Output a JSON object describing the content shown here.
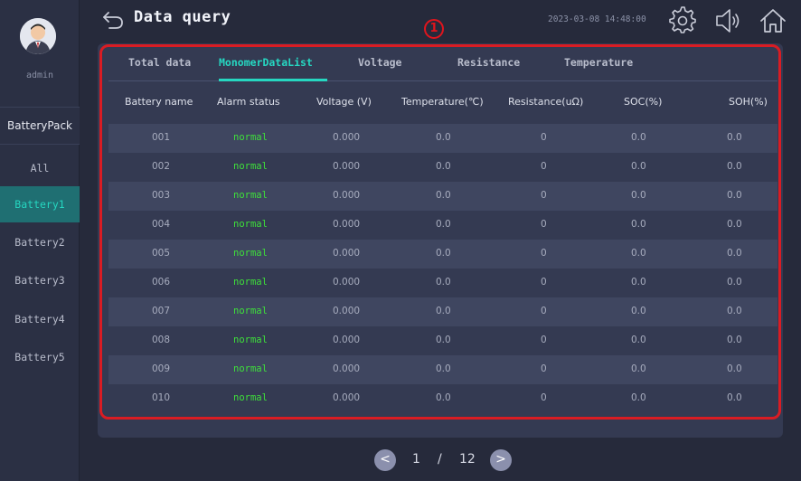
{
  "sidebar": {
    "user": "admin",
    "pack_label": "BatteryPack",
    "items": [
      {
        "label": "All"
      },
      {
        "label": "Battery1"
      },
      {
        "label": "Battery2"
      },
      {
        "label": "Battery3"
      },
      {
        "label": "Battery4"
      },
      {
        "label": "Battery5"
      }
    ],
    "active_item": "Battery1"
  },
  "header": {
    "title": "Data query",
    "datetime": "2023-03-08 14:48:00",
    "annotation": "1",
    "icons": [
      "back-arrow-icon",
      "gear-icon",
      "speaker-icon",
      "home-icon"
    ]
  },
  "tabs": [
    {
      "label": "Total data"
    },
    {
      "label": "MonomerDataList"
    },
    {
      "label": "Voltage"
    },
    {
      "label": "Resistance"
    },
    {
      "label": "Temperature"
    }
  ],
  "active_tab": "MonomerDataList",
  "table": {
    "columns": [
      "Battery name",
      "Alarm status",
      "Voltage (V)",
      "Temperature(℃)",
      "Resistance(uΩ)",
      "SOC(%)",
      "SOH(%)"
    ],
    "rows": [
      [
        "001",
        "normal",
        "0.000",
        "0.0",
        "0",
        "0.0",
        "0.0"
      ],
      [
        "002",
        "normal",
        "0.000",
        "0.0",
        "0",
        "0.0",
        "0.0"
      ],
      [
        "003",
        "normal",
        "0.000",
        "0.0",
        "0",
        "0.0",
        "0.0"
      ],
      [
        "004",
        "normal",
        "0.000",
        "0.0",
        "0",
        "0.0",
        "0.0"
      ],
      [
        "005",
        "normal",
        "0.000",
        "0.0",
        "0",
        "0.0",
        "0.0"
      ],
      [
        "006",
        "normal",
        "0.000",
        "0.0",
        "0",
        "0.0",
        "0.0"
      ],
      [
        "007",
        "normal",
        "0.000",
        "0.0",
        "0",
        "0.0",
        "0.0"
      ],
      [
        "008",
        "normal",
        "0.000",
        "0.0",
        "0",
        "0.0",
        "0.0"
      ],
      [
        "009",
        "normal",
        "0.000",
        "0.0",
        "0",
        "0.0",
        "0.0"
      ],
      [
        "010",
        "normal",
        "0.000",
        "0.0",
        "0",
        "0.0",
        "0.0"
      ]
    ]
  },
  "pager": {
    "current": "1",
    "separator": "/",
    "total": "12",
    "prev": "<",
    "next": ">"
  },
  "colors": {
    "accent": "#26d7c1",
    "status_normal": "#3ee13a",
    "annotation": "#d91c23"
  }
}
